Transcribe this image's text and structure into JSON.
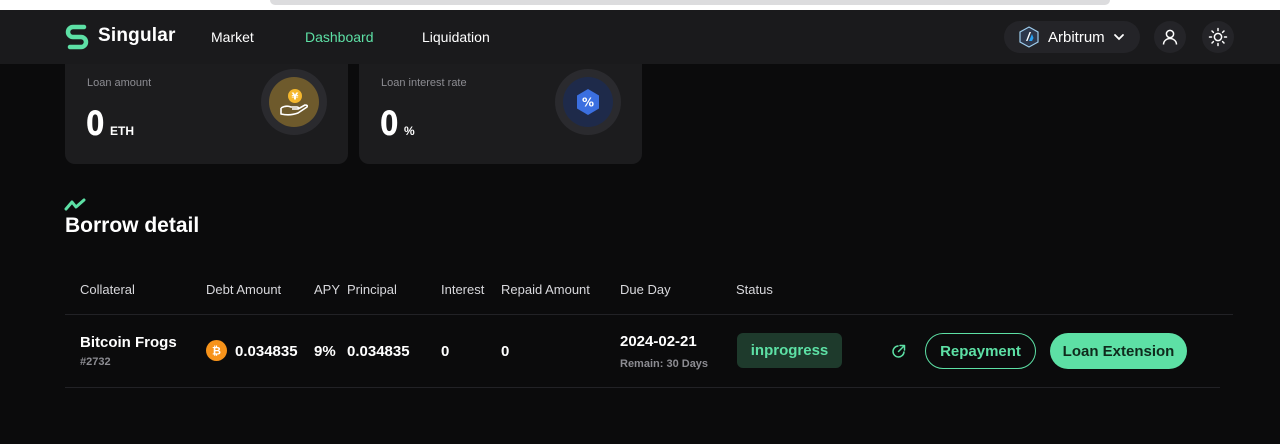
{
  "nav": {
    "brand": "Singular",
    "links": [
      {
        "label": "Market",
        "active": false
      },
      {
        "label": "Dashboard",
        "active": true
      },
      {
        "label": "Liquidation",
        "active": false
      }
    ],
    "network": "Arbitrum",
    "icons": [
      "arbitrum-icon",
      "chevron-down-icon",
      "user-icon",
      "sun-icon"
    ]
  },
  "cards": [
    {
      "label": "Loan amount",
      "value": "0",
      "unit": "ETH",
      "icon": "coin-hand-icon"
    },
    {
      "label": "Loan interest rate",
      "value": "0",
      "unit": "%",
      "icon": "percent-hexagon-icon"
    }
  ],
  "section": {
    "title": "Borrow detail",
    "icon": "trend-icon"
  },
  "table": {
    "columns": [
      "Collateral",
      "Debt Amount",
      "APY",
      "Principal",
      "Interest",
      "Repaid Amount",
      "Due Day",
      "Status"
    ],
    "rows": [
      {
        "collateral_name": "Bitcoin Frogs",
        "collateral_id": "#2732",
        "debt_amount": "0.034835",
        "apy": "9%",
        "principal": "0.034835",
        "interest": "0",
        "repaid_amount": "0",
        "due_day": "2024-02-21",
        "remain": "Remain: 30 Days",
        "status": "inprogress",
        "actions": {
          "repayment": "Repayment",
          "extension": "Loan Extension"
        }
      }
    ]
  },
  "colors": {
    "accent": "#5de0a5",
    "background": "#0b0b0c",
    "card": "#1c1c1e",
    "bitcoin": "#f7931a"
  }
}
